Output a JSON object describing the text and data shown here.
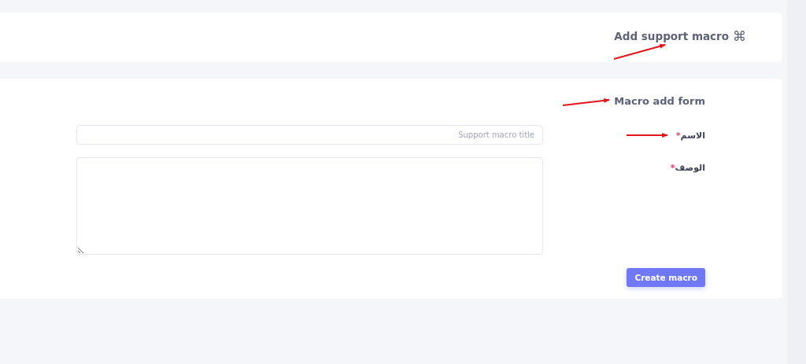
{
  "header": {
    "title": "Add support macro",
    "icon": "⌘"
  },
  "form": {
    "title": "Macro add form",
    "fields": [
      {
        "kind": "input",
        "label": "الاسم",
        "required_mark": "*",
        "placeholder": "Support macro title"
      },
      {
        "kind": "textarea",
        "label": "الوصف",
        "required_mark": "*"
      }
    ],
    "submit": "Create macro"
  }
}
